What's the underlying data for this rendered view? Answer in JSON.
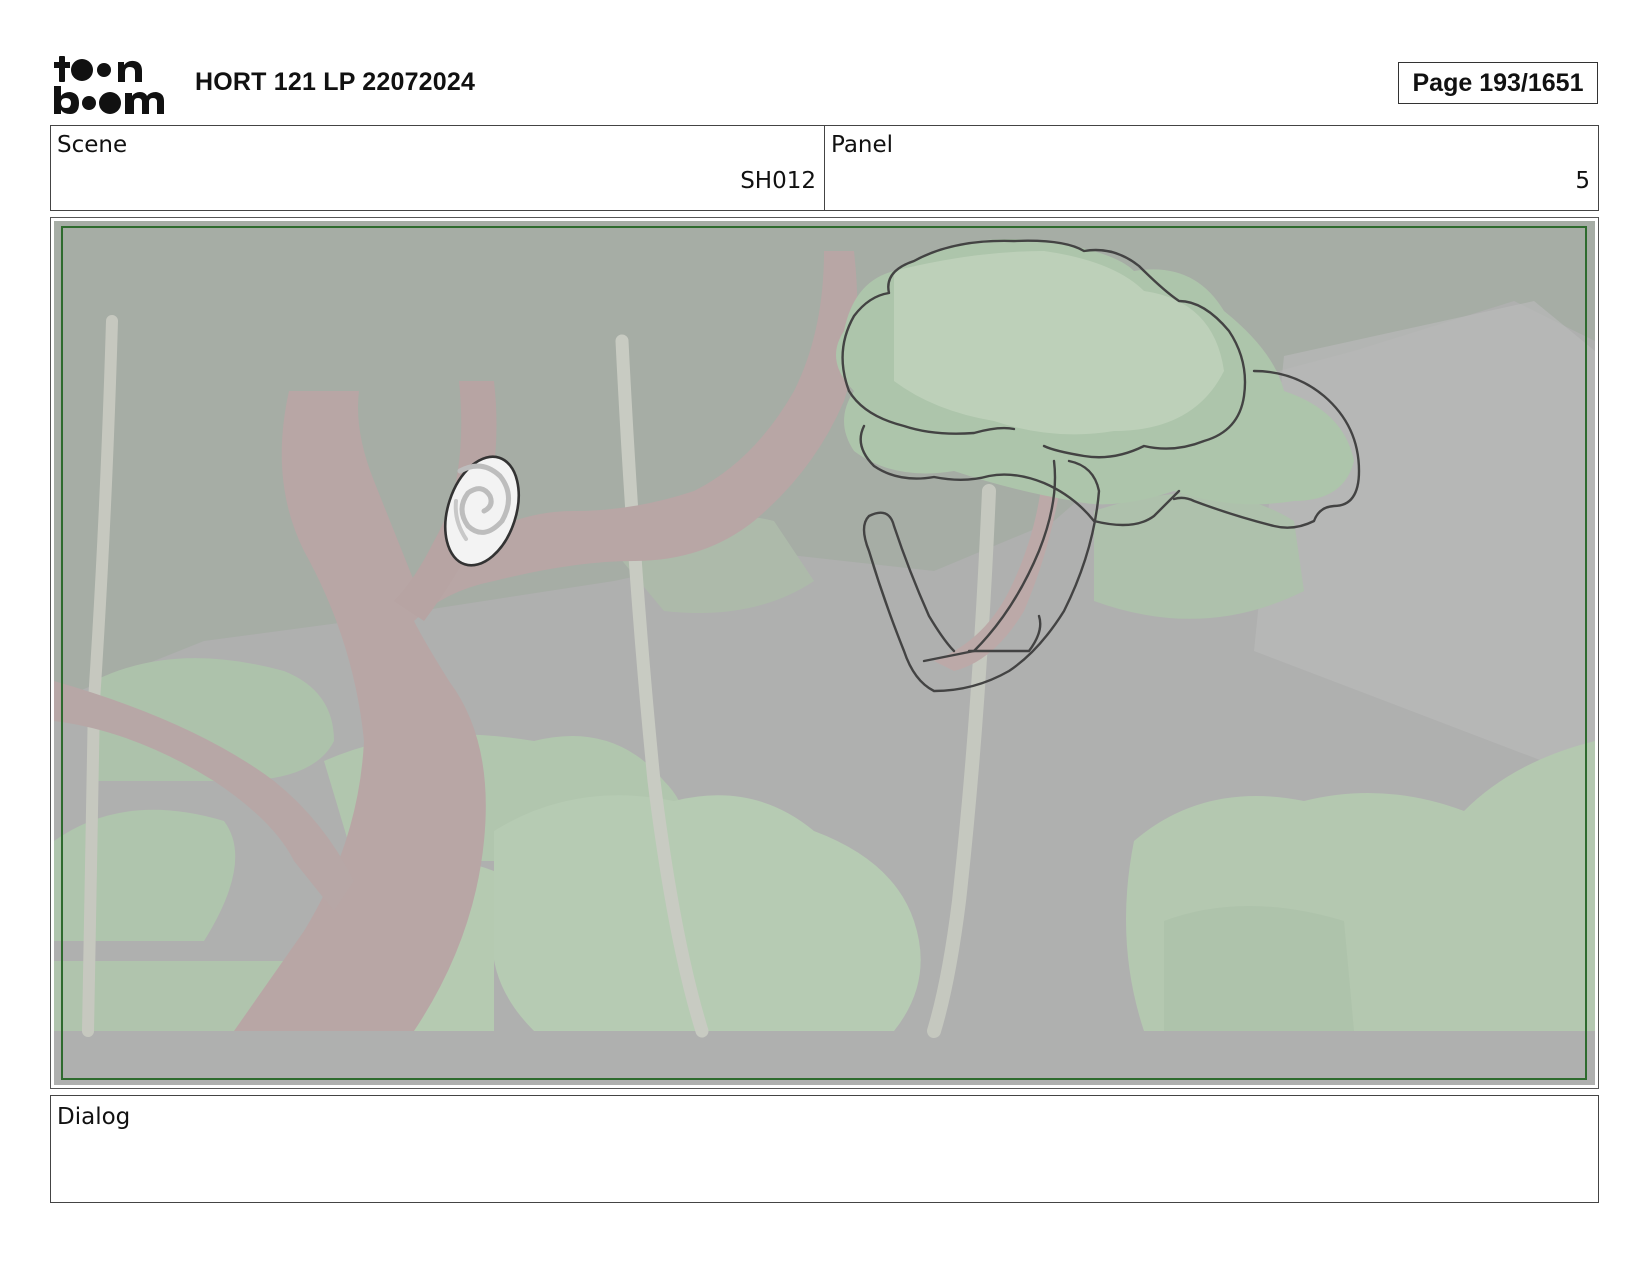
{
  "header": {
    "logo_text_top": "toon",
    "logo_text_bottom": "boom",
    "title": "HORT 121 LP 22072024",
    "page_label": "Page",
    "page_number": "193/1651"
  },
  "info": {
    "scene_label": "Scene",
    "scene_value": "SH012",
    "panel_label": "Panel",
    "panel_value": "5"
  },
  "dialog": {
    "label": "Dialog",
    "text": ""
  },
  "colors": {
    "safe_frame": "#2e6b2e",
    "background_grey": "#a9aaa9",
    "foliage": "#a9c1a6",
    "trunk": "#b29f9e"
  }
}
